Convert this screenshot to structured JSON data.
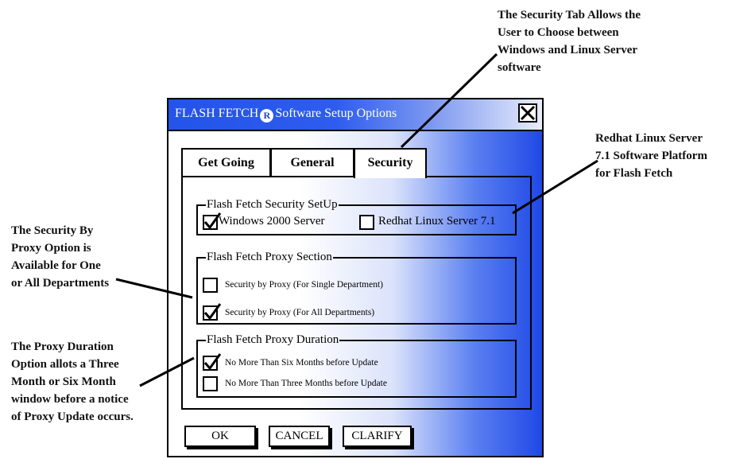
{
  "callouts": {
    "security_tab": [
      "The Security Tab Allows the",
      "User to Choose between",
      "Windows and Linux Server",
      "software"
    ],
    "redhat": [
      "Redhat Linux Server",
      "7.1 Software Platform",
      "for Flash Fetch"
    ],
    "proxy_option": [
      "The Security By",
      "Proxy Option is",
      "Available for One",
      "or All Departments"
    ],
    "proxy_duration": [
      "The Proxy Duration",
      "Option allots a Three",
      "Month or Six Month",
      "window before a notice",
      "of Proxy Update occurs."
    ]
  },
  "window": {
    "title_prefix": "FLASH FETCH",
    "title_mark": "R",
    "title_suffix": "Software Setup Options",
    "close_icon": "close-x-icon"
  },
  "tabs": [
    {
      "label": "Get Going",
      "active": false
    },
    {
      "label": "General",
      "active": false
    },
    {
      "label": "Security",
      "active": true
    }
  ],
  "groups": {
    "security": {
      "legend": "Flash Fetch Security SetUp",
      "options": [
        {
          "label": "Windows 2000 Server",
          "checked": true
        },
        {
          "label": "Redhat Linux Server 7.1",
          "checked": false
        }
      ]
    },
    "proxy": {
      "legend": "Flash Fetch Proxy Section",
      "options": [
        {
          "label": "Security by Proxy (For Single Department)",
          "checked": false
        },
        {
          "label": "Security by Proxy (For All Departments)",
          "checked": true
        }
      ]
    },
    "duration": {
      "legend": "Flash Fetch Proxy Duration",
      "options": [
        {
          "label": "No More Than Six Months before Update",
          "checked": true
        },
        {
          "label": "No More Than Three Months before Update",
          "checked": false
        }
      ]
    }
  },
  "buttons": {
    "ok": "OK",
    "cancel": "CANCEL",
    "clarify": "CLARIFY"
  },
  "colors": {
    "titlebar": "#2453e9",
    "window_gradient_end": "#1f49e6"
  }
}
